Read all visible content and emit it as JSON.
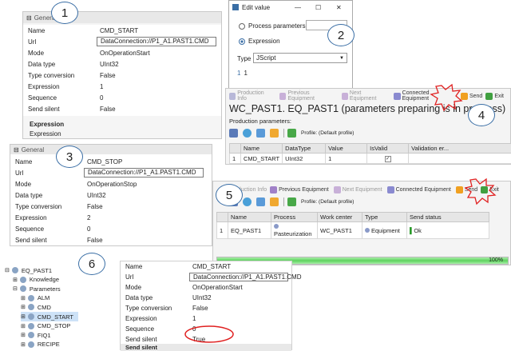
{
  "callouts": [
    "1",
    "2",
    "3",
    "4",
    "5",
    "6"
  ],
  "panel1": {
    "header": "General",
    "rows": [
      {
        "k": "Name",
        "v": "CMD_START"
      },
      {
        "k": "Url",
        "v": "DataConnection://P1_A1.PAST1.CMD"
      },
      {
        "k": "Mode",
        "v": "OnOperationStart"
      },
      {
        "k": "Data type",
        "v": "UInt32"
      },
      {
        "k": "Type conversion",
        "v": "False"
      },
      {
        "k": "Expression",
        "v": "1"
      },
      {
        "k": "Sequence",
        "v": "0"
      },
      {
        "k": "Send silent",
        "v": "False"
      }
    ],
    "desc_title": "Expression",
    "desc_text": "Expression"
  },
  "edit_dialog": {
    "title": "Edit value",
    "min": "—",
    "max": "☐",
    "close": "✕",
    "option1": "Process parameters",
    "option2": "Expression",
    "type_label": "Type",
    "type_value": "JScript",
    "line_number": "1",
    "code": "1"
  },
  "panel4": {
    "toolbar": [
      "Production Info",
      "Previous Equipment",
      "Next Equipment",
      "Connected Equipment",
      "Send",
      "Exit"
    ],
    "title": "WC_PAST1. EQ_PAST1 (parameters preparing is in progress)",
    "section": "Production parameters:",
    "profile": "Profile: (Default profile)",
    "columns": [
      "Name",
      "DataType",
      "Value",
      "IsValid",
      "Validation er..."
    ],
    "row": {
      "idx": "1",
      "name": "CMD_START",
      "type": "UInt32",
      "value": "1",
      "valid": "✓",
      "err": ""
    }
  },
  "panel3": {
    "header": "General",
    "rows": [
      {
        "k": "Name",
        "v": "CMD_STOP"
      },
      {
        "k": "Url",
        "v": "DataConnection://P1_A1.PAST1.CMD"
      },
      {
        "k": "Mode",
        "v": "OnOperationStop"
      },
      {
        "k": "Data type",
        "v": "UInt32"
      },
      {
        "k": "Type conversion",
        "v": "False"
      },
      {
        "k": "Expression",
        "v": "2"
      },
      {
        "k": "Sequence",
        "v": "0"
      },
      {
        "k": "Send silent",
        "v": "False"
      }
    ]
  },
  "panel5": {
    "toolbar": [
      "Production Info",
      "Previous Equipment",
      "Next Equipment",
      "Connected Equipment",
      "Send",
      "Exit"
    ],
    "profile": "Profile: (Default profile)",
    "columns": [
      "Name",
      "Process",
      "Work center",
      "Type",
      "Send status"
    ],
    "row": {
      "idx": "1",
      "name": "EQ_PAST1",
      "process": "Pasteurization",
      "wc": "WC_PAST1",
      "type": "Equipment",
      "status": "Ok"
    },
    "progress": 1.0,
    "progress_label": "100%"
  },
  "tree": {
    "items": [
      {
        "label": "EQ_PAST1",
        "level": 0,
        "exp": "⊟"
      },
      {
        "label": "Knowledge",
        "level": 1,
        "exp": "⊞"
      },
      {
        "label": "Parameters",
        "level": 1,
        "exp": "⊟"
      },
      {
        "label": "ALM",
        "level": 2,
        "exp": "⊞"
      },
      {
        "label": "CMD",
        "level": 2,
        "exp": "⊞"
      },
      {
        "label": "CMD_START",
        "level": 2,
        "exp": "⊞"
      },
      {
        "label": "CMD_STOP",
        "level": 2,
        "exp": "⊞"
      },
      {
        "label": "FIQ1",
        "level": 2,
        "exp": "⊞"
      },
      {
        "label": "RECIPE",
        "level": 2,
        "exp": "⊞"
      }
    ],
    "selected": "CMD_START"
  },
  "panel6": {
    "rows": [
      {
        "k": "Name",
        "v": "CMD_START"
      },
      {
        "k": "Url",
        "v": "DataConnection://P1_A1.PAST1.CMD"
      },
      {
        "k": "Mode",
        "v": "OnOperationStart"
      },
      {
        "k": "Data type",
        "v": "UInt32"
      },
      {
        "k": "Type conversion",
        "v": "False"
      },
      {
        "k": "Expression",
        "v": "1"
      },
      {
        "k": "Sequence",
        "v": "0"
      },
      {
        "k": "Send silent",
        "v": "True"
      }
    ],
    "footer": "Send silent"
  },
  "colors": {
    "accent": "#3a6ea5",
    "highlight_red": "#e02020",
    "progress_green": "#5fd35f",
    "selected_row": "#cde2f7"
  }
}
